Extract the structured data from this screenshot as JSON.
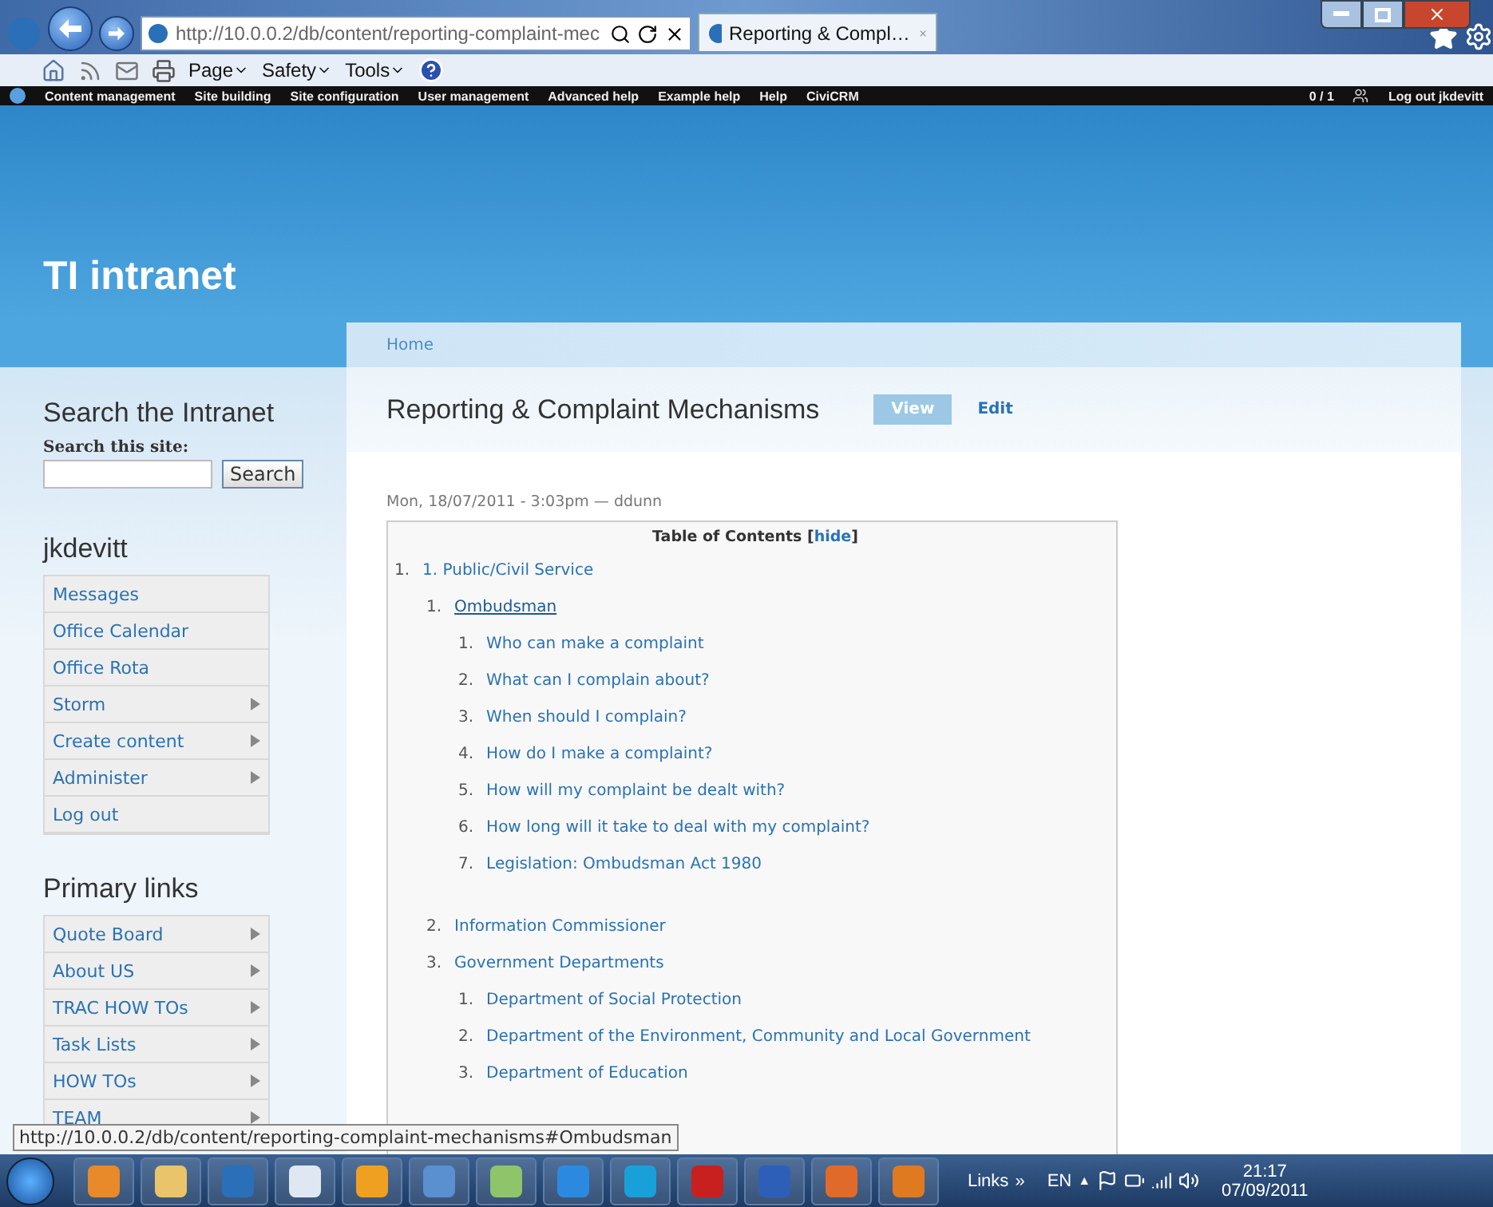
{
  "browser": {
    "address": "http://10.0.0.2/db/content/reporting-complaint-mec",
    "tab_title": "Reporting & Compl…",
    "commands": [
      "Page",
      "Safety",
      "Tools"
    ]
  },
  "admin_bar": {
    "items": [
      "Content management",
      "Site building",
      "Site configuration",
      "User management",
      "Advanced help",
      "Example help",
      "Help",
      "CiviCRM"
    ],
    "users_online": "0 / 1",
    "logout": "Log out jkdevitt"
  },
  "site_name": "TI intranet",
  "breadcrumb": "Home",
  "search": {
    "title": "Search the Intranet",
    "label": "Search this site:",
    "button": "Search"
  },
  "user_menu": {
    "title": "jkdevitt",
    "items": [
      {
        "label": "Messages",
        "has_children": false
      },
      {
        "label": "Office Calendar",
        "has_children": false
      },
      {
        "label": "Office Rota",
        "has_children": false
      },
      {
        "label": "Storm",
        "has_children": true
      },
      {
        "label": "Create content",
        "has_children": true
      },
      {
        "label": "Administer",
        "has_children": true
      },
      {
        "label": "Log out",
        "has_children": false
      }
    ]
  },
  "primary_links": {
    "title": "Primary links",
    "items": [
      {
        "label": "Quote Board",
        "has_children": true
      },
      {
        "label": "About US",
        "has_children": true
      },
      {
        "label": "TRAC HOW TOs",
        "has_children": true
      },
      {
        "label": "Task Lists",
        "has_children": true
      },
      {
        "label": "HOW TOs",
        "has_children": true
      },
      {
        "label": "TEAM",
        "has_children": true
      }
    ]
  },
  "page": {
    "title": "Reporting & Complaint Mechanisms",
    "tabs": [
      {
        "label": "View",
        "selected": true
      },
      {
        "label": "Edit",
        "selected": false
      }
    ],
    "submitted": "Mon, 18/07/2011 - 3:03pm — ddunn"
  },
  "toc": {
    "title": "Table of Contents",
    "toggle_open": "[",
    "toggle": "hide",
    "toggle_close": "]",
    "items": [
      {
        "number": "1.",
        "label": "1. Public/Civil Service",
        "hovered": false,
        "children": [
          {
            "number": "1.",
            "label": "Ombudsman",
            "hovered": true,
            "children": [
              {
                "number": "1.",
                "label": "Who can make a complaint",
                "hovered": false
              },
              {
                "number": "2.",
                "label": "What can I complain about?",
                "hovered": false
              },
              {
                "number": "3.",
                "label": "When should I complain?",
                "hovered": false
              },
              {
                "number": "4.",
                "label": "How do I make a complaint?",
                "hovered": false
              },
              {
                "number": "5.",
                "label": "How will my complaint be dealt with?",
                "hovered": false
              },
              {
                "number": "6.",
                "label": "How long will it take to deal with my complaint?",
                "hovered": false
              },
              {
                "number": "7.",
                "label": "Legislation: Ombudsman Act 1980",
                "hovered": false
              }
            ]
          },
          {
            "number": "2.",
            "label": "Information Commissioner",
            "hovered": false
          },
          {
            "number": "3.",
            "label": "Government Departments",
            "hovered": false,
            "children": [
              {
                "number": "1.",
                "label": "Department of Social Protection",
                "hovered": false
              },
              {
                "number": "2.",
                "label": "Department of the Environment, Community and Local Government",
                "hovered": false
              },
              {
                "number": "3.",
                "label": "Department of Education",
                "hovered": false
              }
            ]
          }
        ]
      }
    ]
  },
  "status_url": "http://10.0.0.2/db/content/reporting-complaint-mechanisms#Ombudsman",
  "taskbar": {
    "apps": [
      {
        "color": "#e8892a"
      },
      {
        "color": "#e9c46a"
      },
      {
        "color": "#2a6fb8"
      },
      {
        "color": "#dfe8f2"
      },
      {
        "color": "#f0a020"
      },
      {
        "color": "#5a8fd0"
      },
      {
        "color": "#8fc46a"
      },
      {
        "color": "#2b8ae0"
      },
      {
        "color": "#1aa0d8"
      },
      {
        "color": "#c8201e"
      },
      {
        "color": "#2e5fb8"
      },
      {
        "color": "#e06a2a"
      },
      {
        "color": "#e07a20"
      }
    ],
    "links": "Links",
    "chevron": "»",
    "language": "EN",
    "tray_toggle": "▲",
    "time": "21:17",
    "date": "07/09/2011"
  }
}
